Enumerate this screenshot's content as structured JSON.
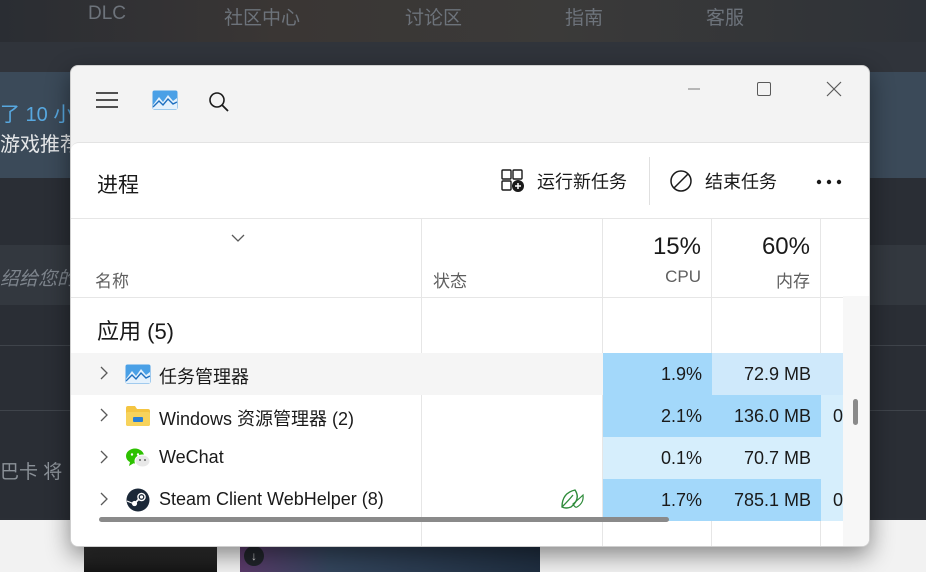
{
  "background": {
    "nav": [
      "DLC",
      "社区中心",
      "讨论区",
      "指南",
      "客服"
    ],
    "link_text": "了 10 小",
    "text1": "游戏推荐",
    "text2": "绍给您的",
    "text3": "巴卡 将"
  },
  "window": {
    "page_title": "进程",
    "run_new_task": "运行新任务",
    "end_task": "结束任务"
  },
  "columns": {
    "name": "名称",
    "status": "状态",
    "cpu_pct": "15%",
    "cpu": "CPU",
    "mem_pct": "60%",
    "mem": "内存"
  },
  "group": {
    "label": "应用 (5)"
  },
  "processes": [
    {
      "name": "任务管理器",
      "cpu": "1.9%",
      "mem": "72.9 MB",
      "extra": "",
      "icon": "task-manager-icon",
      "cpu_color": "#a3d8fa",
      "mem_color": "#cfe9fb"
    },
    {
      "name": "Windows 资源管理器 (2)",
      "cpu": "2.1%",
      "mem": "136.0 MB",
      "extra": "0",
      "icon": "folder-icon",
      "cpu_color": "#a3d8fa",
      "mem_color": "#a3d8fa"
    },
    {
      "name": "WeChat",
      "cpu": "0.1%",
      "mem": "70.7 MB",
      "extra": "",
      "icon": "wechat-icon",
      "cpu_color": "#d6eefc",
      "mem_color": "#d6eefc"
    },
    {
      "name": "Steam Client WebHelper (8)",
      "cpu": "1.7%",
      "mem": "785.1 MB",
      "extra": "0",
      "icon": "steam-icon",
      "cpu_color": "#a3d8fa",
      "mem_color": "#a3d8fa",
      "status_icon": "efficiency-leaf-icon"
    }
  ]
}
